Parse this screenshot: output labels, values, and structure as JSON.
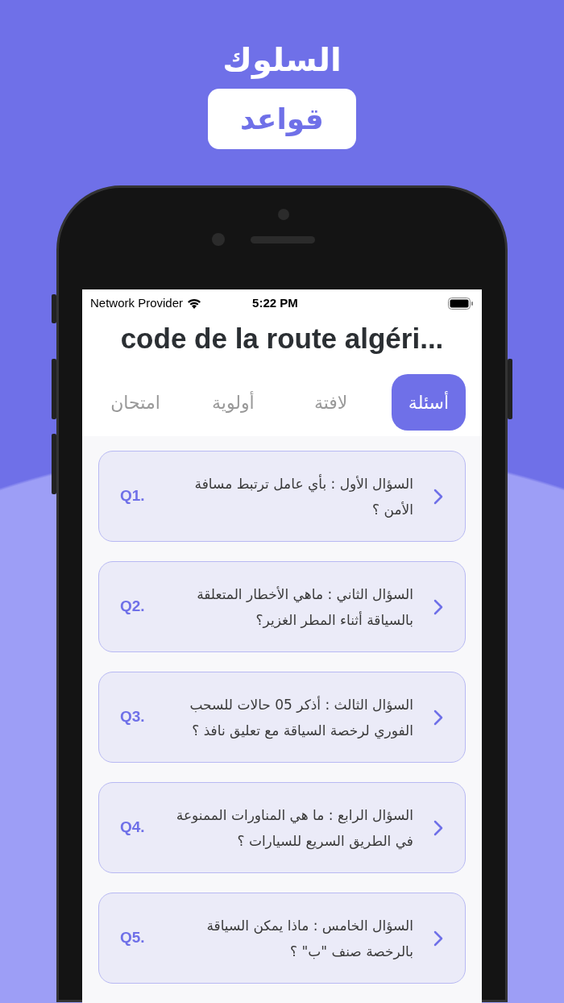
{
  "header": {
    "title": "السلوك",
    "badge": "قواعد"
  },
  "status_bar": {
    "carrier": "Network Provider",
    "time": "5:22 PM"
  },
  "app": {
    "title": "code de la route algéri...",
    "tabs": [
      {
        "label": "أسئلة",
        "selected": true
      },
      {
        "label": "لافتة",
        "selected": false
      },
      {
        "label": "أولوية",
        "selected": false
      },
      {
        "label": "امتحان",
        "selected": false
      }
    ],
    "questions": [
      {
        "number": "Q1.",
        "text": "السؤال الأول : بأي عامل ترتبط مسافة الأمن ؟"
      },
      {
        "number": "Q2.",
        "text": "السؤال الثاني : ماهي الأخطار المتعلقة بالسياقة أثناء المطر الغزير؟"
      },
      {
        "number": "Q3.",
        "text": "السؤال الثالث : أذكر 05 حالات للسحب الفوري لرخصة السياقة مع تعليق نافذ ؟"
      },
      {
        "number": "Q4.",
        "text": "السؤال الرابع : ما هي المناورات الممنوعة في الطريق السريع للسيارات ؟"
      },
      {
        "number": "Q5.",
        "text": "السؤال الخامس : ماذا يمكن السياقة بالرخصة صنف \"ب\" ؟"
      }
    ]
  }
}
